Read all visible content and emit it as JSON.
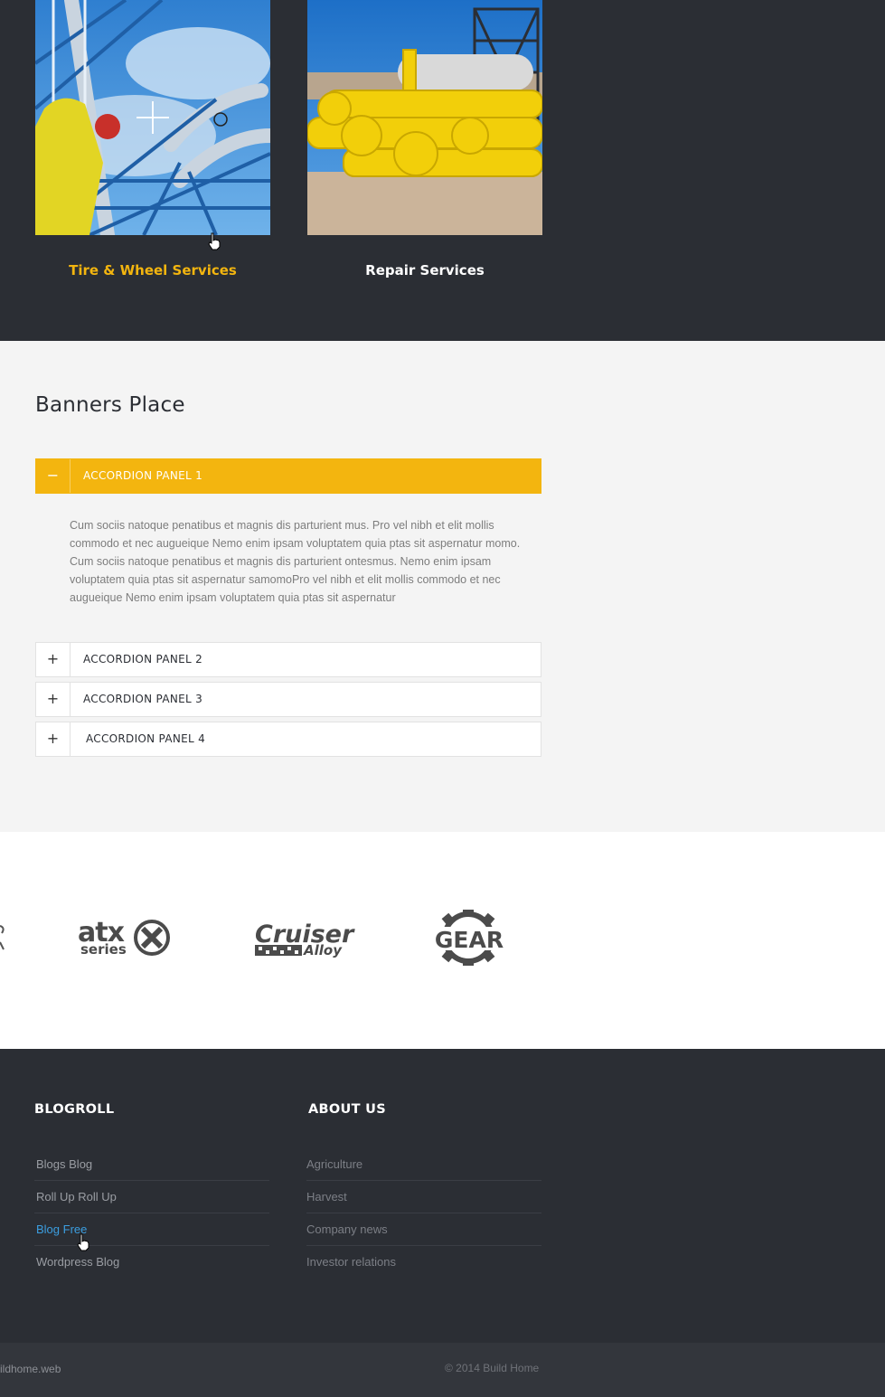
{
  "colors": {
    "accent": "#f3b50f",
    "dark": "#2b2e34",
    "link_hover": "#3b9ee0"
  },
  "services": [
    {
      "title": "Tire & Wheel Services",
      "active": true
    },
    {
      "title": "Repair Services",
      "active": false
    }
  ],
  "banners": {
    "heading": "Banners Place",
    "panels": [
      {
        "label": "ACCORDION PANEL 1",
        "toggle": "−",
        "open": true,
        "body": "Cum sociis natoque penatibus et magnis dis parturient mus. Pro vel nibh et elit mollis commodo et nec augueique Nemo enim ipsam voluptatem quia ptas sit aspernatur momo. Cum sociis natoque penatibus et magnis dis parturient ontesmus. Nemo enim ipsam voluptatem quia ptas sit aspernatur samomoPro vel nibh et elit mollis commodo et nec augueique Nemo enim ipsam voluptatem quia ptas sit aspernatur"
      },
      {
        "label": "ACCORDION PANEL 2",
        "toggle": "+",
        "open": false
      },
      {
        "label": "ACCORDION PANEL 3",
        "toggle": "+",
        "open": false
      },
      {
        "label": "ACCORDION PANEL 4",
        "toggle": "+",
        "open": false
      }
    ]
  },
  "partners": {
    "logos": [
      {
        "name": "atx-series-logo",
        "text_1": "atx",
        "text_2": "series"
      },
      {
        "name": "cruiser-alloy-logo",
        "text_1": "Cruiser",
        "text_2": "Alloy"
      },
      {
        "name": "gear-logo",
        "text_1": "GEAR"
      }
    ]
  },
  "footer": {
    "blogroll": {
      "heading": "BLOGROLL",
      "items": [
        "Blogs Blog",
        "Roll Up Roll Up",
        "Blog Free",
        "Wordpress Blog"
      ]
    },
    "about": {
      "heading": "ABOUT US",
      "items": [
        "Agriculture",
        "Harvest",
        "Company news",
        "Investor relations"
      ]
    },
    "bottom_left": "ildhome.web",
    "copyright": "© 2014 Build Home"
  }
}
